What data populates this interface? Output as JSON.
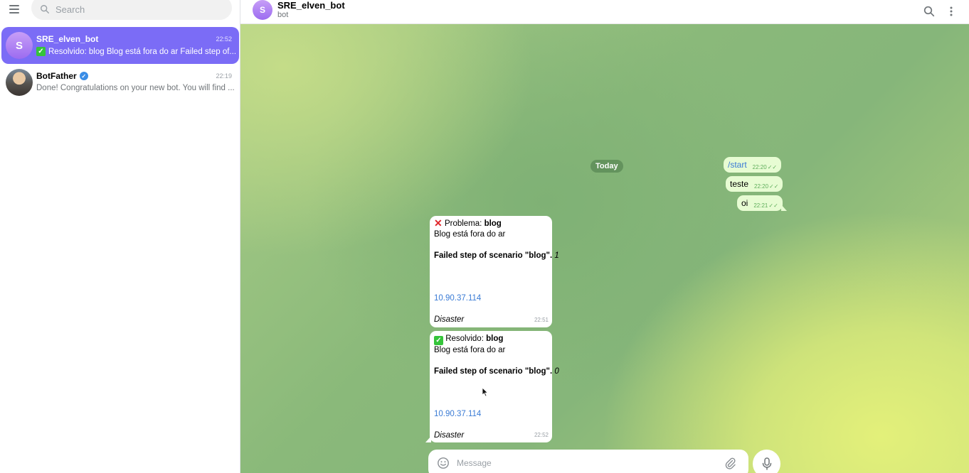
{
  "sidebar": {
    "search_placeholder": "Search",
    "chats": [
      {
        "avatar_letter": "S",
        "title": "SRE_elven_bot",
        "time": "22:52",
        "preview": "Resolvido: blog Blog está fora do ar Failed step of...",
        "preview_icon": "check-emoji-icon",
        "active": true
      },
      {
        "title": "BotFather",
        "time": "22:19",
        "preview": "Done! Congratulations on your new bot. You will find ...",
        "verified": true,
        "active": false
      }
    ]
  },
  "header": {
    "avatar_letter": "S",
    "name": "SRE_elven_bot",
    "status": "bot"
  },
  "conversation": {
    "date_label": "Today",
    "outgoing": [
      {
        "text": "/start",
        "time": "22:20"
      },
      {
        "text": "teste",
        "time": "22:20"
      },
      {
        "text": "oi",
        "time": "22:21"
      }
    ],
    "incoming": [
      {
        "label": "Problema:",
        "subject": "blog",
        "line2": "Blog está fora do ar",
        "step_label": "Failed step of scenario \"blog\".",
        "step_value": "1",
        "ip": "10.90.37.114",
        "severity": "Disaster",
        "time": "22:51"
      },
      {
        "label": "Resolvido:",
        "subject": "blog",
        "line2": "Blog está fora do ar",
        "step_label": "Failed step of scenario \"blog\".",
        "step_value": "0",
        "ip": "10.90.37.114",
        "severity": "Disaster",
        "time": "22:52"
      }
    ]
  },
  "composer": {
    "placeholder": "Message"
  },
  "colors": {
    "active_chat": "#7b6cf6",
    "outgoing_bubble": "#e7fcd3",
    "link": "#3a7bd5"
  }
}
